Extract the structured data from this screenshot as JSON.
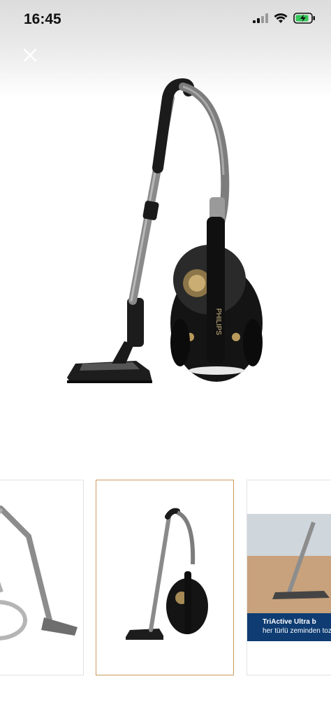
{
  "status_bar": {
    "time": "16:45"
  },
  "gallery": {
    "close_icon": "close-icon",
    "selected_index": 1,
    "thumbnails": [
      {
        "name": "vacuum-grey-variant"
      },
      {
        "name": "vacuum-black-variant"
      },
      {
        "name": "vacuum-floor-scene",
        "caption_title": "TriActive Ultra b",
        "caption_sub": "her türlü zeminden toz v"
      }
    ],
    "brand_text": "PHILIPS"
  },
  "colors": {
    "selected_border": "#c99b5a",
    "caption_band": "#0e3c73",
    "battery_green": "#34c759"
  }
}
